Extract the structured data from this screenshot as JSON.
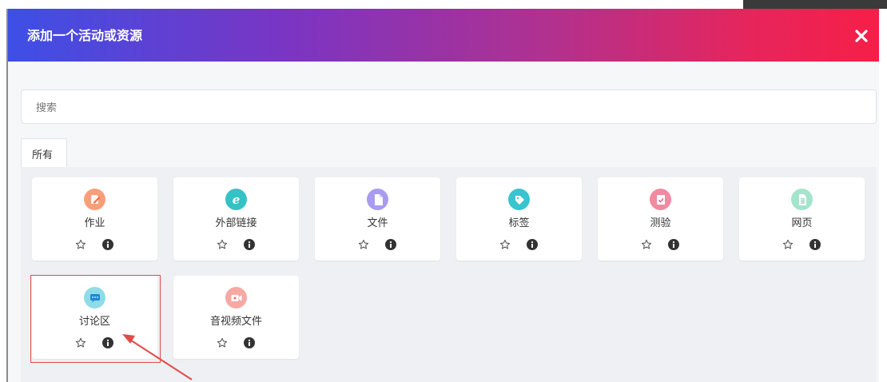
{
  "modal": {
    "title": "添加一个活动或资源",
    "close_symbol": "×"
  },
  "search": {
    "placeholder": "搜索"
  },
  "tabs": [
    {
      "label": "所有",
      "active": true
    }
  ],
  "items": [
    {
      "label": "作业",
      "icon": "assignment-icon",
      "color": "#f89f79"
    },
    {
      "label": "外部链接",
      "icon": "external-link-icon",
      "color": "#34c3c4"
    },
    {
      "label": "文件",
      "icon": "file-icon",
      "color": "#a99bf0"
    },
    {
      "label": "标签",
      "icon": "tag-icon",
      "color": "#39c4cf"
    },
    {
      "label": "测验",
      "icon": "quiz-icon",
      "color": "#f08aa0"
    },
    {
      "label": "网页",
      "icon": "page-icon",
      "color": "#a5e4cc"
    },
    {
      "label": "讨论区",
      "icon": "forum-icon",
      "color": "#8fdbe8"
    },
    {
      "label": "音视频文件",
      "icon": "video-icon",
      "color": "#f6a9a3"
    }
  ],
  "item_actions": {
    "star": "star-icon",
    "info": "info-icon"
  },
  "annotation": {
    "highlight_color": "#e24a4a",
    "highlighted_item": "讨论区"
  },
  "colors": {
    "header_gradient": [
      "#3d4fe6",
      "#7a35c3",
      "#b1318f",
      "#e6255c",
      "#f61f48"
    ],
    "background": "#f6f7f9",
    "card": "#ffffff"
  }
}
